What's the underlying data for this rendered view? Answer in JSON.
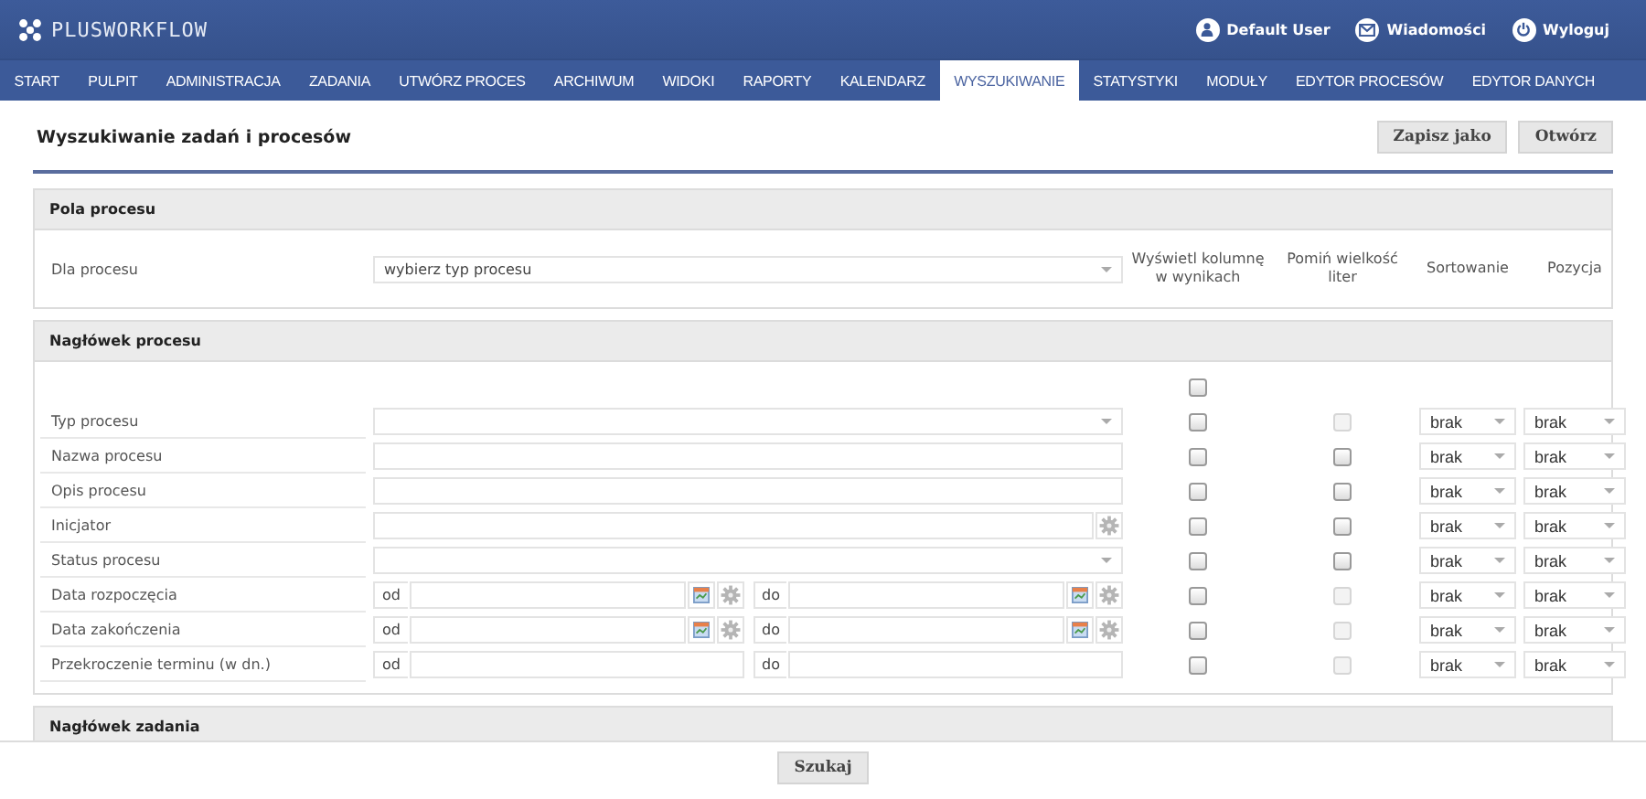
{
  "brand": {
    "name": "PLUSWORKFLOW"
  },
  "user_menu": [
    {
      "kind": "user",
      "label": "Default User"
    },
    {
      "kind": "messages",
      "label": "Wiadomości"
    },
    {
      "kind": "logout",
      "label": "Wyloguj"
    }
  ],
  "nav": [
    {
      "label": "START",
      "selected": false
    },
    {
      "label": "PULPIT",
      "selected": false
    },
    {
      "label": "ADMINISTRACJA",
      "selected": false
    },
    {
      "label": "ZADANIA",
      "selected": false
    },
    {
      "label": "UTWÓRZ PROCES",
      "selected": false
    },
    {
      "label": "ARCHIWUM",
      "selected": false
    },
    {
      "label": "WIDOKI",
      "selected": false
    },
    {
      "label": "RAPORTY",
      "selected": false
    },
    {
      "label": "KALENDARZ",
      "selected": false
    },
    {
      "label": "WYSZUKIWANIE",
      "selected": true
    },
    {
      "label": "STATYSTYKI",
      "selected": false
    },
    {
      "label": "MODUŁY",
      "selected": false
    },
    {
      "label": "EDYTOR PROCESÓW",
      "selected": false
    },
    {
      "label": "EDYTOR DANYCH",
      "selected": false
    }
  ],
  "page": {
    "title": "Wyszukiwanie zadań i procesów",
    "buttons": [
      "Zapisz jako",
      "Otwórz"
    ]
  },
  "process_fields": {
    "title": "Pola procesu",
    "label": "Dla procesu",
    "placeholder": "wybierz typ procesu",
    "columns": [
      "Wyświetl kolumnę w wynikach",
      "Pomiń wielkość liter",
      "Sortowanie",
      "Pozycja"
    ]
  },
  "process_header": {
    "title": "Nagłówek procesu",
    "select_all": {
      "checked": false
    },
    "rows": [
      {
        "label": "Typ procesu",
        "kind": "select",
        "display": false,
        "ignore_case": false,
        "ignore_case_disabled": true,
        "sort": "brak",
        "position": "brak"
      },
      {
        "label": "Nazwa procesu",
        "kind": "text",
        "display": false,
        "ignore_case": false,
        "ignore_case_disabled": false,
        "sort": "brak",
        "position": "brak"
      },
      {
        "label": "Opis procesu",
        "kind": "text",
        "display": false,
        "ignore_case": false,
        "ignore_case_disabled": false,
        "sort": "brak",
        "position": "brak"
      },
      {
        "label": "Inicjator",
        "kind": "picker",
        "display": false,
        "ignore_case": false,
        "ignore_case_disabled": false,
        "sort": "brak",
        "position": "brak"
      },
      {
        "label": "Status procesu",
        "kind": "select",
        "display": false,
        "ignore_case": false,
        "ignore_case_disabled": false,
        "sort": "brak",
        "position": "brak"
      },
      {
        "label": "Data rozpoczęcia",
        "kind": "date",
        "from_label": "od",
        "to_label": "do",
        "display": false,
        "ignore_case": false,
        "ignore_case_disabled": true,
        "sort": "brak",
        "position": "brak"
      },
      {
        "label": "Data zakończenia",
        "kind": "date",
        "from_label": "od",
        "to_label": "do",
        "display": false,
        "ignore_case": false,
        "ignore_case_disabled": true,
        "sort": "brak",
        "position": "brak"
      },
      {
        "label": "Przekroczenie terminu (w dn.)",
        "kind": "range",
        "from_label": "od",
        "to_label": "do",
        "display": false,
        "ignore_case": false,
        "ignore_case_disabled": true,
        "sort": "brak",
        "position": "brak"
      }
    ]
  },
  "task_header": {
    "title": "Nagłówek zadania"
  },
  "footer": {
    "button": "Szukaj"
  }
}
